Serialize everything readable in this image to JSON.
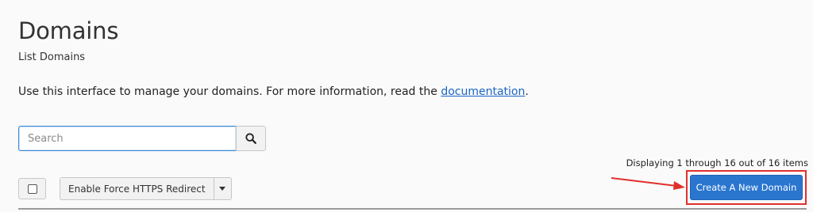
{
  "header": {
    "title": "Domains",
    "subtitle": "List Domains"
  },
  "intro": {
    "text_before": "Use this interface to manage your domains. For more information, read the ",
    "link_text": "documentation",
    "text_after": "."
  },
  "search": {
    "placeholder": "Search",
    "value": "",
    "button_icon": "search-icon"
  },
  "results": {
    "display_count": "Displaying 1 through 16 out of 16 items"
  },
  "toolbar": {
    "select_all_checked": false,
    "https_button_label": "Enable Force HTTPS Redirect",
    "https_caret_icon": "chevron-down-icon",
    "create_button_label": "Create A New Domain"
  },
  "annotation": {
    "color": "#e0302c"
  },
  "colors": {
    "primary_button": "#2a76cf",
    "link": "#1a66c4",
    "search_focus_border": "#3a88d6"
  }
}
